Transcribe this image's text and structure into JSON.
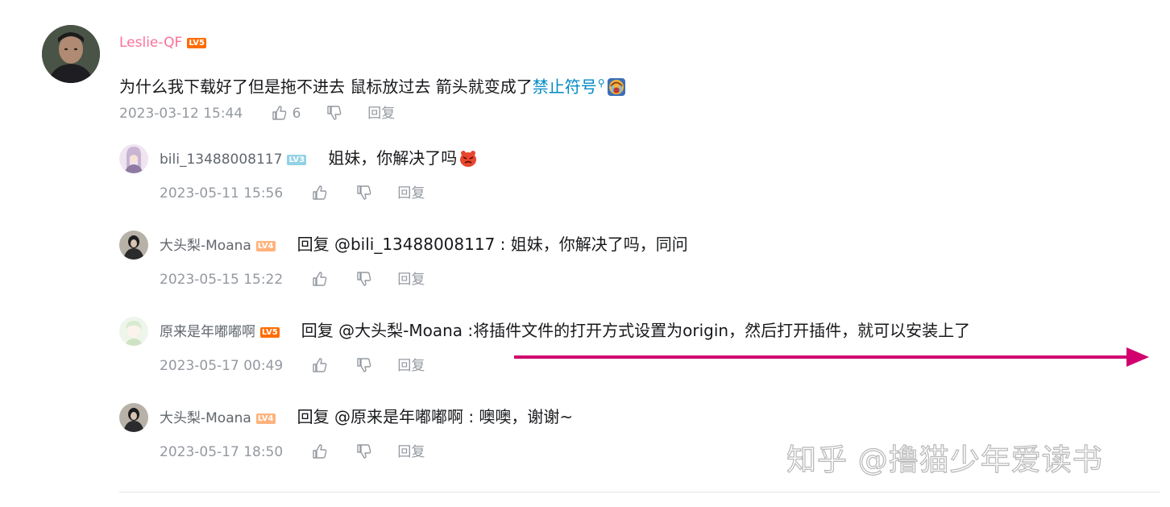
{
  "root_comment": {
    "username": "Leslie-QF",
    "level": "LV5",
    "text": "为什么我下载好了但是拖不进去  鼠标放过去  箭头就变成了",
    "link_text": "禁止符号",
    "emoji": "crying-emoji",
    "timestamp": "2023-03-12 15:44",
    "like_count": "6",
    "reply_label": "回复"
  },
  "sub_replies": [
    {
      "username": "bili_13488008117",
      "level": "LV3",
      "prefix": "",
      "mention": "",
      "text": "姐妹，你解决了吗",
      "emoji": "angry-emoji",
      "timestamp": "2023-05-11 15:56",
      "reply_label": "回复"
    },
    {
      "username": "大头梨-Moana",
      "level": "LV4",
      "prefix": "回复 ",
      "mention": "@bili_13488008117",
      "text": " : 姐妹，你解决了吗，同问",
      "emoji": "",
      "timestamp": "2023-05-15 15:22",
      "reply_label": "回复"
    },
    {
      "username": "原来是年嘟嘟啊",
      "level": "LV5",
      "prefix": "回复 ",
      "mention": "@大头梨-Moana",
      "text": " :将插件文件的打开方式设置为origin，然后打开插件，就可以安装上了",
      "emoji": "",
      "timestamp": "2023-05-17 00:49",
      "reply_label": "回复"
    },
    {
      "username": "大头梨-Moana",
      "level": "LV4",
      "prefix": "回复 ",
      "mention": "@原来是年嘟嘟啊",
      "text": " : 噢噢，谢谢~",
      "emoji": "",
      "timestamp": "2023-05-17 18:50",
      "reply_label": "回复"
    }
  ],
  "annotation": {
    "arrow_color": "#d1006e"
  },
  "watermark": "知乎 @撸猫少年爱读书",
  "colors": {
    "username_vip": "#fb7299",
    "link": "#008ac5",
    "meta": "#9499a0",
    "lv5": "#ff6c00",
    "lv4": "#ffb37c",
    "lv3": "#92d1e5"
  }
}
